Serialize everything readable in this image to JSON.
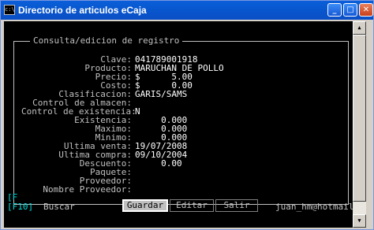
{
  "window": {
    "title": "Directorio de articulos eCaja",
    "icon_label": "c:\\"
  },
  "titlebar_buttons": {
    "minimize": "_",
    "maximize": "□",
    "close": "✕"
  },
  "form": {
    "title": "Consulta/edicion de registro",
    "fields": [
      {
        "label": "Clave:",
        "value": "041789001918"
      },
      {
        "label": "Producto:",
        "value": "MARUCHAN DE POLLO"
      },
      {
        "label": "Precio:",
        "value": "$      5.00"
      },
      {
        "label": "Costo:",
        "value": "$      0.00"
      },
      {
        "label": "Clasificacion:",
        "value": "GARIS/SAMS"
      },
      {
        "label": "Control de almacen:",
        "value": ""
      },
      {
        "label": "Control de existencia:",
        "value": "N"
      },
      {
        "label": "Existencia:",
        "value": "     0.000"
      },
      {
        "label": "Maximo:",
        "value": "     0.000"
      },
      {
        "label": "Minimo:",
        "value": "     0.000"
      },
      {
        "label": "Ultima venta:",
        "value": "19/07/2008"
      },
      {
        "label": "Ultima compra:",
        "value": "09/10/2004"
      },
      {
        "label": "Descuento:",
        "value": "     0.00"
      },
      {
        "label": "Paquete:",
        "value": ""
      },
      {
        "label": "Proveedor:",
        "value": ""
      },
      {
        "label": "Nombre Proveedor:",
        "value": ""
      }
    ]
  },
  "footer": {
    "fkey_partial": "[F",
    "fkey_f10": "[F10]",
    "buscar": "Buscar",
    "buttons": {
      "guardar": "Guardar",
      "editar": "Editar",
      "salir": "Salir"
    },
    "email": "juan_hm@hotmail.com"
  }
}
